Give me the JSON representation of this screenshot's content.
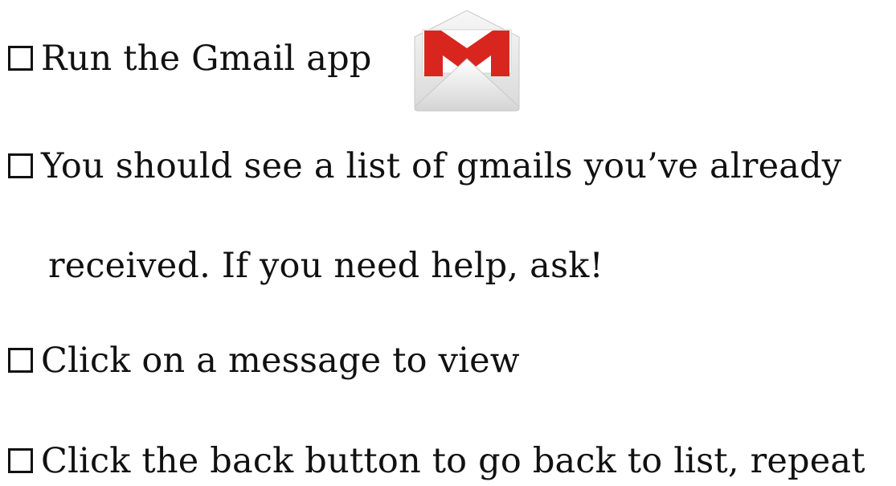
{
  "checklist": {
    "items": [
      {
        "text": "Run the Gmail app"
      },
      {
        "text": "You should see a list of gmails you’ve already"
      },
      {
        "text": "received.  If you need help, ask!"
      },
      {
        "text": "Click on a message to view"
      },
      {
        "text": "Click the back button to go back to list, repeat"
      }
    ]
  },
  "icons": {
    "bullet": "checkbox-icon",
    "app_logo": "gmail-icon"
  },
  "colors": {
    "background": "#ffffff",
    "text": "#111111",
    "gmail_red": "#d8261f",
    "gmail_envelope": "#eeeeee"
  }
}
